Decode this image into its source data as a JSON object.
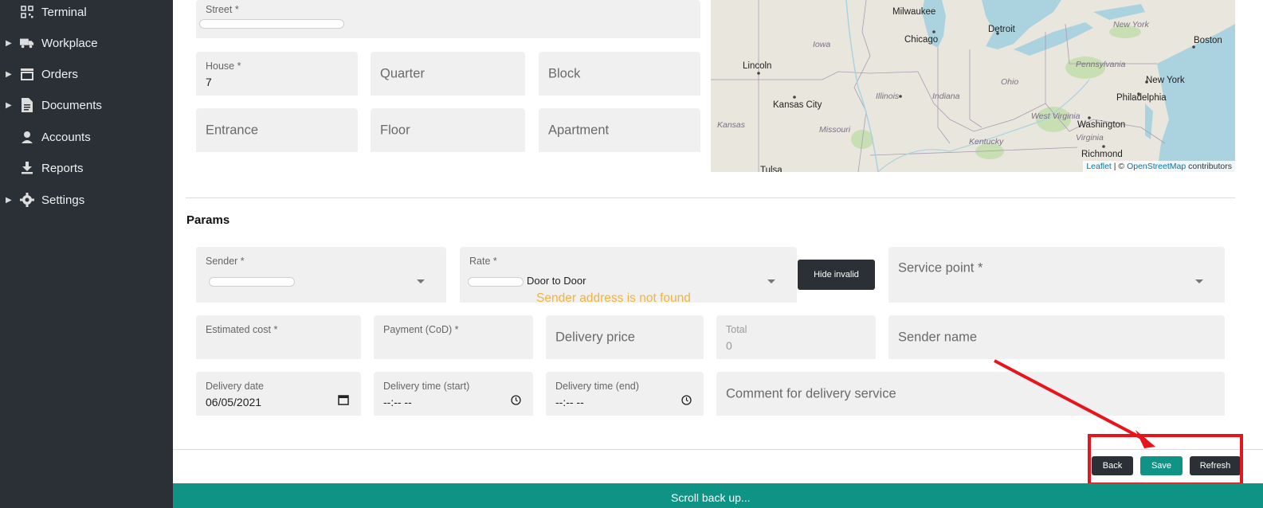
{
  "sidebar": {
    "items": [
      {
        "label": "Terminal",
        "icon": "qr-grid-icon",
        "expandable": false
      },
      {
        "label": "Workplace",
        "icon": "truck-icon",
        "expandable": true
      },
      {
        "label": "Orders",
        "icon": "store-icon",
        "expandable": true
      },
      {
        "label": "Documents",
        "icon": "document-icon",
        "expandable": true
      },
      {
        "label": "Accounts",
        "icon": "user-icon",
        "expandable": false
      },
      {
        "label": "Reports",
        "icon": "download-icon",
        "expandable": false
      },
      {
        "label": "Settings",
        "icon": "gear-icon",
        "expandable": true
      }
    ]
  },
  "address": {
    "street_label": "Street *",
    "house_label": "House *",
    "house_value": "7",
    "quarter_placeholder": "Quarter",
    "block_placeholder": "Block",
    "entrance_placeholder": "Entrance",
    "floor_placeholder": "Floor",
    "apartment_placeholder": "Apartment"
  },
  "map": {
    "cities": [
      "Milwaukee",
      "Detroit",
      "New York",
      "Boston",
      "Chicago",
      "Lincoln",
      "New York",
      "Philadelphia",
      "Kansas City",
      "Washington",
      "Richmond",
      "Tulsa"
    ],
    "states": [
      "Iowa",
      "Pennsylvania",
      "Ohio",
      "Illinois",
      "Indiana",
      "Kansas",
      "Missouri",
      "West Virginia",
      "Virginia",
      "Kentucky"
    ],
    "attribution_link1": "Leaflet",
    "attribution_sep": " | © ",
    "attribution_link2": "OpenStreetMap",
    "attribution_tail": " contributors",
    "colors": {
      "land": "#e9e6dd",
      "water": "#aad3df",
      "forest": "#c8dfb3"
    }
  },
  "params": {
    "title": "Params",
    "sender_label": "Sender *",
    "rate_label": "Rate *",
    "rate_value": "Door to Door",
    "hide_invalid_label": "Hide invalid",
    "service_point_placeholder": "Service point *",
    "warning": "Sender address is not found",
    "estimated_cost_label": "Estimated cost *",
    "payment_label": "Payment (CoD) *",
    "delivery_price_placeholder": "Delivery price",
    "total_label": "Total",
    "total_value": "0",
    "sender_name_placeholder": "Sender name",
    "delivery_date_label": "Delivery date",
    "delivery_date_value": "06/05/2021",
    "delivery_time_start_label": "Delivery time (start)",
    "delivery_time_start_value": "--:-- --",
    "delivery_time_end_label": "Delivery time (end)",
    "delivery_time_end_value": "--:-- --",
    "comment_placeholder": "Comment for delivery service"
  },
  "actions": {
    "back_label": "Back",
    "save_label": "Save",
    "refresh_label": "Refresh"
  },
  "footer": {
    "scroll_label": "Scroll back up..."
  },
  "colors": {
    "sidebar": "#2b3036",
    "accent": "#0e9384",
    "warning": "#f0b43c",
    "highlight": "#e8141c"
  }
}
